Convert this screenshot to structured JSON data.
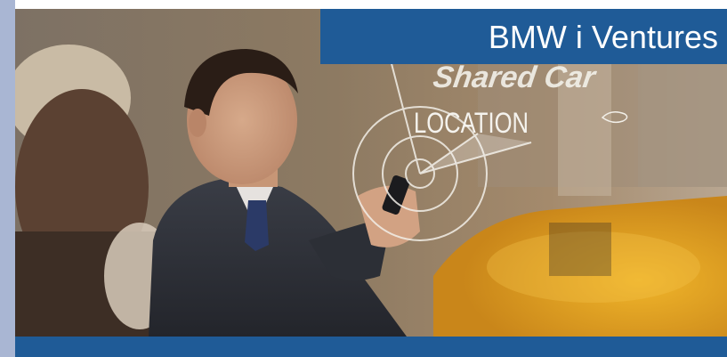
{
  "slide": {
    "title": "BMW i Ventures"
  },
  "photo": {
    "overlay_heading": "Shared Car",
    "overlay_label": "LOCATION"
  },
  "colors": {
    "title_band": "#1f5b97",
    "left_strip": "#a9b6d3",
    "taxi_yellow": "#e3a21a"
  }
}
